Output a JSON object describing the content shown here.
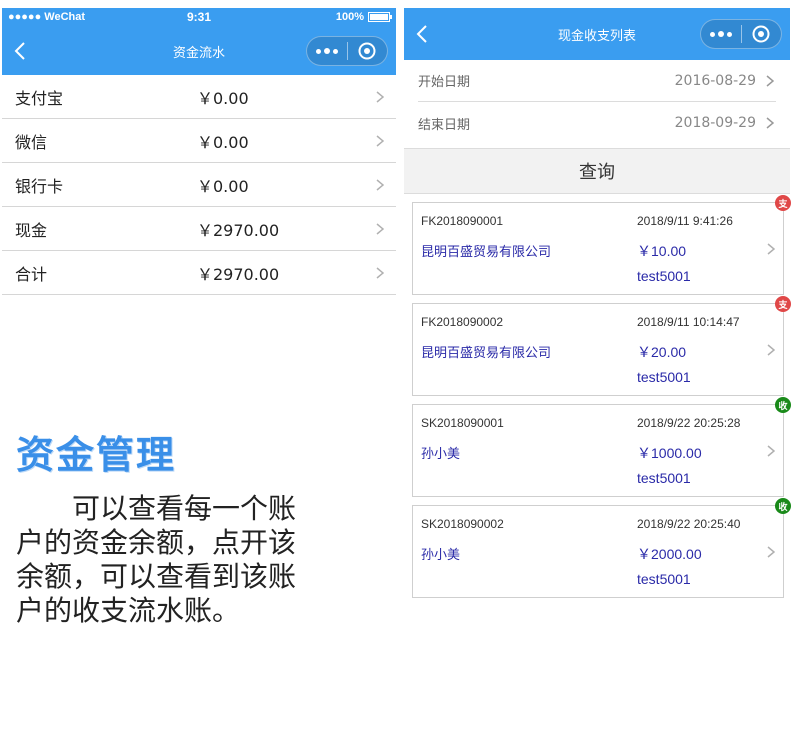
{
  "colors": {
    "accent": "#3a9df0",
    "link": "#2a2aa8",
    "badge_pay": "#e04848",
    "badge_receive": "#1a8a1a",
    "promo_title": "#3a8fe8"
  },
  "left_phone": {
    "status": {
      "carrier": "●●●●● WeChat",
      "time": "9:31",
      "battery": "100%"
    },
    "nav": {
      "title": "资金流水"
    },
    "accounts": [
      {
        "name": "支付宝",
        "amount": "￥0.00"
      },
      {
        "name": "微信",
        "amount": "￥0.00"
      },
      {
        "name": "银行卡",
        "amount": "￥0.00"
      },
      {
        "name": "现金",
        "amount": "￥2970.00"
      },
      {
        "name": "合计",
        "amount": "￥2970.00"
      }
    ]
  },
  "promo": {
    "title": "资金管理",
    "body": "可以查看每一个账户的资金余额，点开该余额，可以查看到该账户的收支流水账。"
  },
  "right_phone": {
    "nav": {
      "title": "现金收支列表"
    },
    "start_date": {
      "label": "开始日期",
      "value": "2016-08-29"
    },
    "end_date": {
      "label": "结束日期",
      "value": "2018-09-29"
    },
    "query_label": "查询",
    "records": [
      {
        "no": "FK2018090001",
        "datetime": "2018/9/11 9:41:26",
        "party": "昆明百盛贸易有限公司",
        "amount": "￥10.00",
        "user": "test5001",
        "badge": "支",
        "badge_type": "pay"
      },
      {
        "no": "FK2018090002",
        "datetime": "2018/9/11 10:14:47",
        "party": "昆明百盛贸易有限公司",
        "amount": "￥20.00",
        "user": "test5001",
        "badge": "支",
        "badge_type": "pay"
      },
      {
        "no": "SK2018090001",
        "datetime": "2018/9/22 20:25:28",
        "party": "孙小美",
        "amount": "￥1000.00",
        "user": "test5001",
        "badge": "收",
        "badge_type": "receive"
      },
      {
        "no": "SK2018090002",
        "datetime": "2018/9/22 20:25:40",
        "party": "孙小美",
        "amount": "￥2000.00",
        "user": "test5001",
        "badge": "收",
        "badge_type": "receive"
      }
    ]
  }
}
